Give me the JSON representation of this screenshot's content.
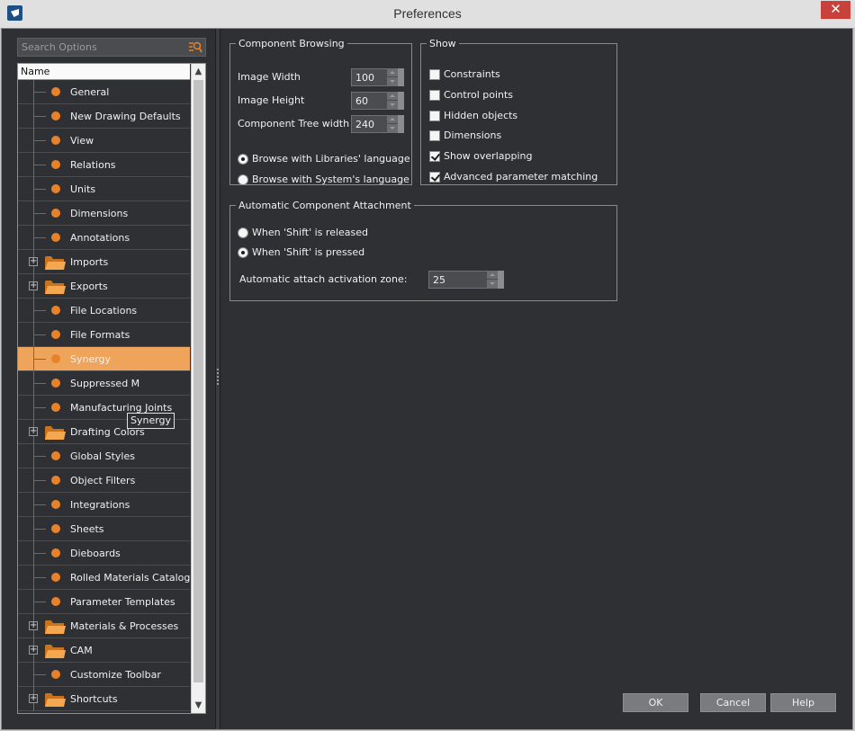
{
  "window": {
    "title": "Preferences",
    "close_glyph": "✕"
  },
  "search": {
    "placeholder": "Search Options"
  },
  "tree": {
    "header": "Name",
    "items": [
      {
        "label": "General",
        "kind": "leaf"
      },
      {
        "label": "New Drawing Defaults",
        "kind": "leaf"
      },
      {
        "label": "View",
        "kind": "leaf"
      },
      {
        "label": "Relations",
        "kind": "leaf"
      },
      {
        "label": "Units",
        "kind": "leaf"
      },
      {
        "label": "Dimensions",
        "kind": "leaf"
      },
      {
        "label": "Annotations",
        "kind": "leaf"
      },
      {
        "label": "Imports",
        "kind": "folder"
      },
      {
        "label": "Exports",
        "kind": "folder"
      },
      {
        "label": "File Locations",
        "kind": "leaf"
      },
      {
        "label": "File Formats",
        "kind": "leaf"
      },
      {
        "label": "Synergy",
        "kind": "leaf",
        "selected": true
      },
      {
        "label": "Suppressed M",
        "kind": "leaf"
      },
      {
        "label": "Manufacturing Joints",
        "kind": "leaf"
      },
      {
        "label": "Drafting Colors",
        "kind": "folder"
      },
      {
        "label": "Global Styles",
        "kind": "leaf"
      },
      {
        "label": "Object Filters",
        "kind": "leaf"
      },
      {
        "label": "Integrations",
        "kind": "leaf"
      },
      {
        "label": "Sheets",
        "kind": "leaf"
      },
      {
        "label": "Dieboards",
        "kind": "leaf"
      },
      {
        "label": "Rolled Materials Catalog",
        "kind": "leaf"
      },
      {
        "label": "Parameter Templates",
        "kind": "leaf"
      },
      {
        "label": "Materials & Processes",
        "kind": "folder"
      },
      {
        "label": "CAM",
        "kind": "folder"
      },
      {
        "label": "Customize Toolbar",
        "kind": "leaf"
      },
      {
        "label": "Shortcuts",
        "kind": "folder"
      }
    ],
    "tooltip": "Synergy",
    "expander_glyph": "+",
    "scroll_up_glyph": "▲",
    "scroll_down_glyph": "▼"
  },
  "component_browsing": {
    "legend": "Component Browsing",
    "image_width_label": "Image Width",
    "image_width_value": "100",
    "image_height_label": "Image Height",
    "image_height_value": "60",
    "tree_width_label": "Component Tree width",
    "tree_width_value": "240",
    "radio_libraries": "Browse with Libraries' language",
    "radio_system": "Browse with System's language"
  },
  "show": {
    "legend": "Show",
    "constraints": "Constraints",
    "control_points": "Control points",
    "hidden_objects": "Hidden objects",
    "dimensions": "Dimensions",
    "show_overlapping": "Show overlapping",
    "advanced_parameter_matching": "Advanced parameter matching"
  },
  "attachment": {
    "legend": "Automatic Component Attachment",
    "radio_released": "When 'Shift' is released",
    "radio_pressed": "When 'Shift' is pressed",
    "zone_label": "Automatic attach activation zone:",
    "zone_value": "25"
  },
  "buttons": {
    "ok": "OK",
    "cancel": "Cancel",
    "help": "Help"
  },
  "colors": {
    "accent": "#eea45b",
    "bullet": "#e8822a",
    "background": "#2f3034"
  }
}
